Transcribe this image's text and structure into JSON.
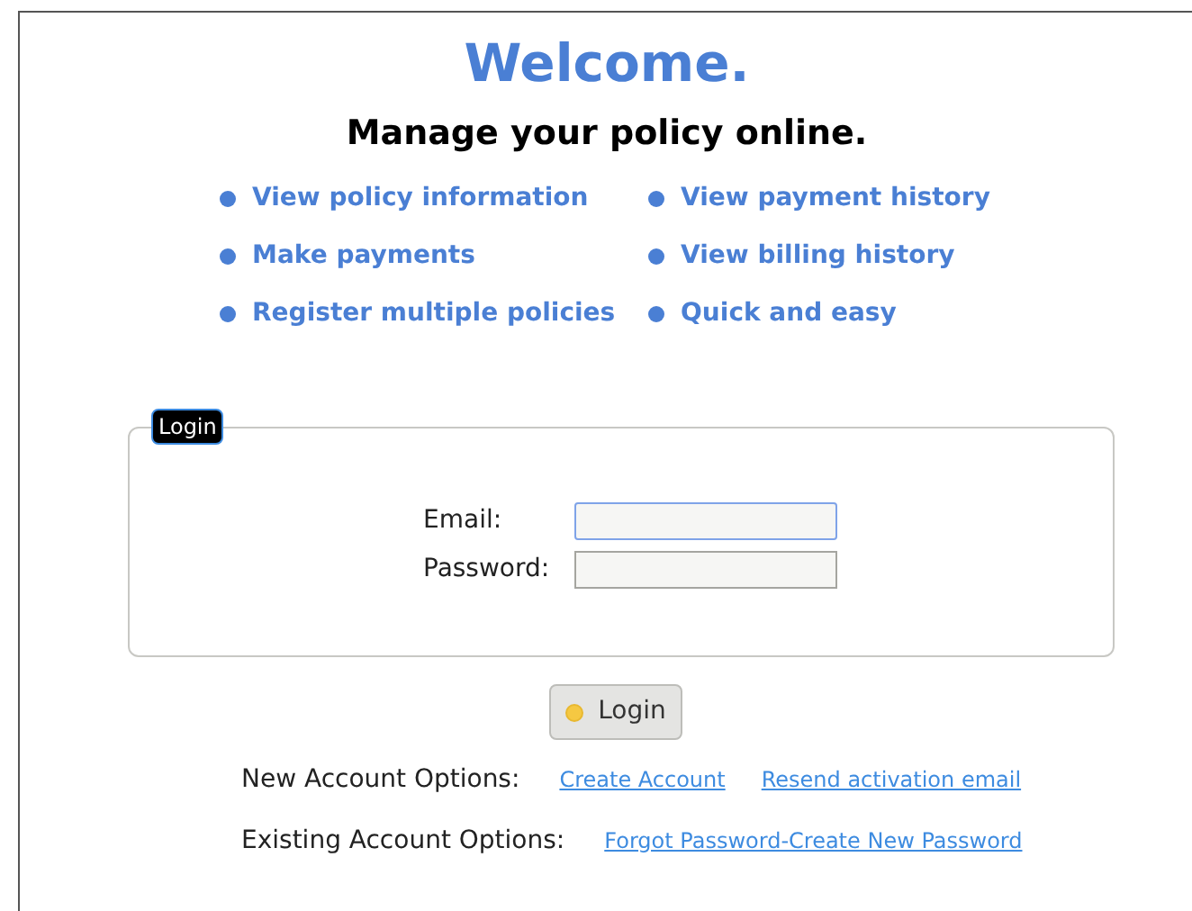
{
  "heading": "Welcome.",
  "subheading": "Manage your policy online.",
  "features": [
    [
      "View policy information",
      "Make payments",
      "Register multiple policies"
    ],
    [
      "View payment history",
      "View billing history",
      "Quick and easy"
    ]
  ],
  "login_panel": {
    "legend": "Login",
    "fields": [
      {
        "label": "Email:",
        "focused": true
      },
      {
        "label": "Password:",
        "focused": false
      }
    ]
  },
  "login_button": "Login",
  "options": [
    {
      "label": "New Account Options:",
      "links": [
        "Create Account",
        "Resend activation email"
      ]
    },
    {
      "label": "Existing Account Options:",
      "links": [
        "Forgot Password-Create New Password"
      ]
    }
  ]
}
